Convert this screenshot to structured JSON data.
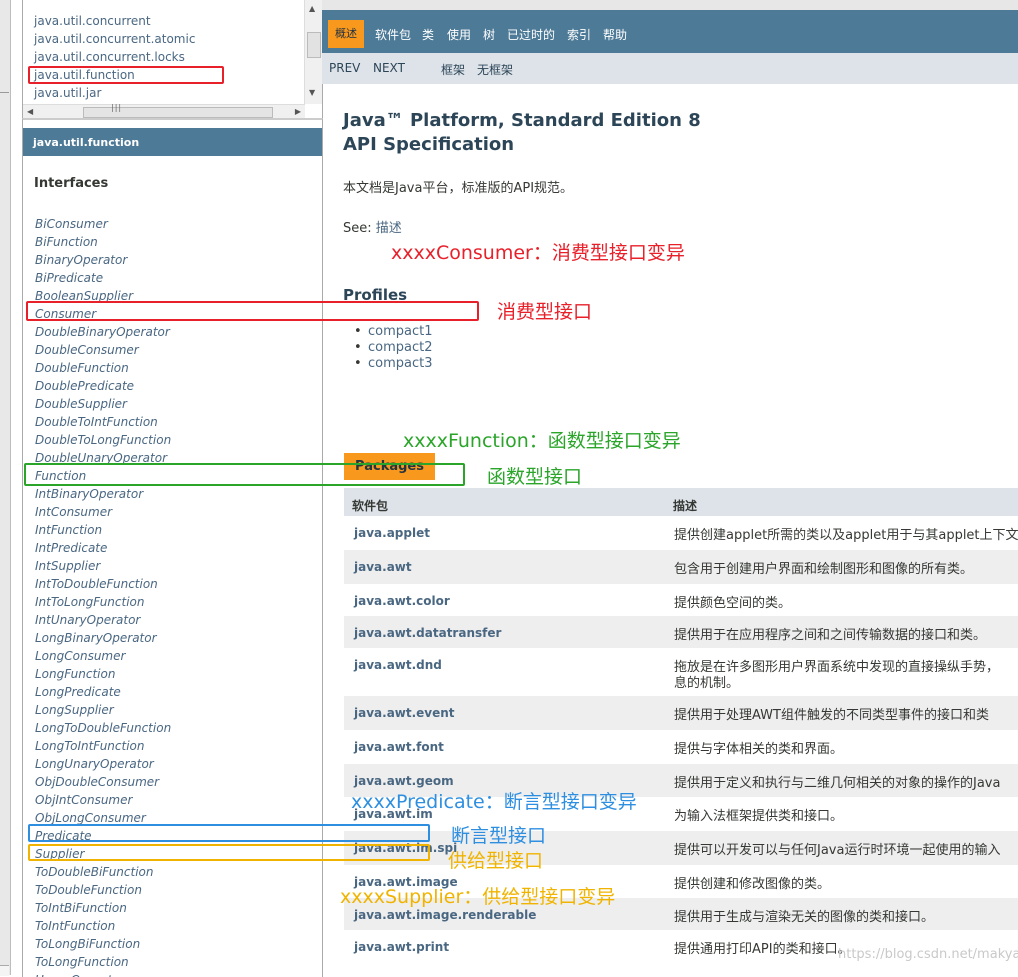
{
  "packages_list": [
    "java.util.concurrent",
    "java.util.concurrent.atomic",
    "java.util.concurrent.locks",
    "java.util.function",
    "java.util.jar"
  ],
  "class_frame": {
    "header": "java.util.function",
    "section": "Interfaces",
    "classes": [
      "BiConsumer",
      "BiFunction",
      "BinaryOperator",
      "BiPredicate",
      "BooleanSupplier",
      "Consumer",
      "DoubleBinaryOperator",
      "DoubleConsumer",
      "DoubleFunction",
      "DoublePredicate",
      "DoubleSupplier",
      "DoubleToIntFunction",
      "DoubleToLongFunction",
      "DoubleUnaryOperator",
      "Function",
      "IntBinaryOperator",
      "IntConsumer",
      "IntFunction",
      "IntPredicate",
      "IntSupplier",
      "IntToDoubleFunction",
      "IntToLongFunction",
      "IntUnaryOperator",
      "LongBinaryOperator",
      "LongConsumer",
      "LongFunction",
      "LongPredicate",
      "LongSupplier",
      "LongToDoubleFunction",
      "LongToIntFunction",
      "LongUnaryOperator",
      "ObjDoubleConsumer",
      "ObjIntConsumer",
      "ObjLongConsumer",
      "Predicate",
      "Supplier",
      "ToDoubleBiFunction",
      "ToDoubleFunction",
      "ToIntBiFunction",
      "ToIntFunction",
      "ToLongBiFunction",
      "ToLongFunction",
      "UnaryOperator"
    ]
  },
  "nav": {
    "overview": "概述",
    "items": [
      "软件包",
      "类",
      "使用",
      "树",
      "已过时的",
      "索引",
      "帮助"
    ],
    "prev": "PREV",
    "next": "NEXT",
    "frames": "框架",
    "no_frames": "无框架"
  },
  "main": {
    "title_line1": "Java™ Platform, Standard Edition 8",
    "title_line2": "API Specification",
    "description": "本文档是Java平台，标准版的API规范。",
    "see_label": "See: ",
    "see_link": "描述",
    "profiles_title": "Profiles",
    "profiles": [
      "compact1",
      "compact2",
      "compact3"
    ],
    "packages_tab": "Packages",
    "table_headers": [
      "软件包",
      "描述"
    ],
    "rows": [
      {
        "pkg": "java.applet",
        "desc": "提供创建applet所需的类以及applet用于与其applet上下文"
      },
      {
        "pkg": "java.awt",
        "desc": "包含用于创建用户界面和绘制图形和图像的所有类。"
      },
      {
        "pkg": "java.awt.color",
        "desc": "提供颜色空间的类。"
      },
      {
        "pkg": "java.awt.datatransfer",
        "desc": "提供用于在应用程序之间和之间传输数据的接口和类。"
      },
      {
        "pkg": "java.awt.dnd",
        "desc": "拖放是在许多图形用户界面系统中发现的直接操纵手势，\n息的机制。"
      },
      {
        "pkg": "java.awt.event",
        "desc": "提供用于处理AWT组件触发的不同类型事件的接口和类"
      },
      {
        "pkg": "java.awt.font",
        "desc": "提供与字体相关的类和界面。"
      },
      {
        "pkg": "java.awt.geom",
        "desc": "提供用于定义和执行与二维几何相关的对象的操作的Java"
      },
      {
        "pkg": "java.awt.im",
        "desc": "为输入法框架提供类和接口。"
      },
      {
        "pkg": "java.awt.im.spi",
        "desc": "提供可以开发可以与任何Java运行时环境一起使用的输入"
      },
      {
        "pkg": "java.awt.image",
        "desc": "提供创建和修改图像的类。"
      },
      {
        "pkg": "java.awt.image.renderable",
        "desc": "提供用于生成与渲染无关的图像的类和接口。"
      },
      {
        "pkg": "java.awt.print",
        "desc": "提供通用打印API的类和接口。"
      }
    ]
  },
  "annotations": {
    "consumer_variant": "xxxxConsumer：消费型接口变异",
    "consumer": "消费型接口",
    "function_variant": "xxxxFunction：函数型接口变异",
    "function": "函数型接口",
    "predicate_variant": "xxxxPredicate：断言型接口变异",
    "predicate": "断言型接口",
    "supplier": "供给型接口",
    "supplier_variant": "xxxxSupplier：供给型接口变异"
  },
  "colors": {
    "nav_blue": "#4d7a97",
    "orange": "#f8981d",
    "red": "#e8202a",
    "green": "#2aa52a",
    "blue": "#2e8fe0",
    "yellow": "#f0b400"
  },
  "watermark": "https://blog.csdn.net/makyan"
}
